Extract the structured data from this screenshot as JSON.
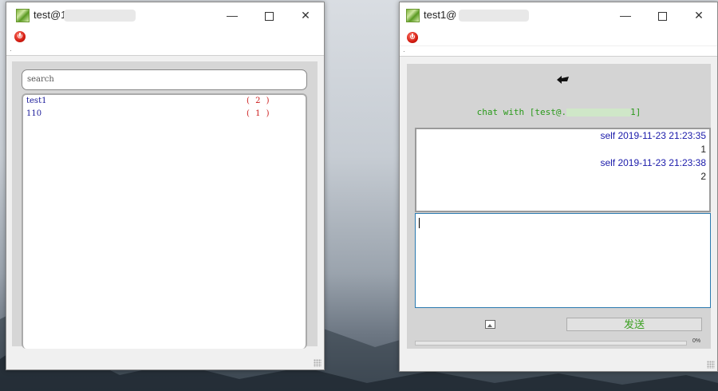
{
  "colors": {
    "accent_blue": "#1a1aaa",
    "count_red": "#cc1a1a",
    "chat_green": "#2a9a1a"
  },
  "contacts_window": {
    "title": "test@1",
    "search": {
      "placeholder": "search"
    },
    "contacts": [
      {
        "name": "test1",
        "count": "( 2 )"
      },
      {
        "name": "110",
        "count": "( 1 )"
      }
    ]
  },
  "chat_window": {
    "title": "test1@",
    "chat_with": {
      "prefix": "chat with [test@.",
      "suffix": "1]"
    },
    "messages": [
      {
        "header": "self  2019-11-23 21:23:35",
        "body": "1"
      },
      {
        "header": "self  2019-11-23 21:23:38",
        "body": "2"
      }
    ],
    "send_label": "发送",
    "progress_label": "0%"
  },
  "icons": [
    "app-icon",
    "minimize-icon",
    "maximize-icon",
    "close-icon",
    "power-icon",
    "back-arrow-icon",
    "image-icon",
    "resize-grip-icon"
  ]
}
